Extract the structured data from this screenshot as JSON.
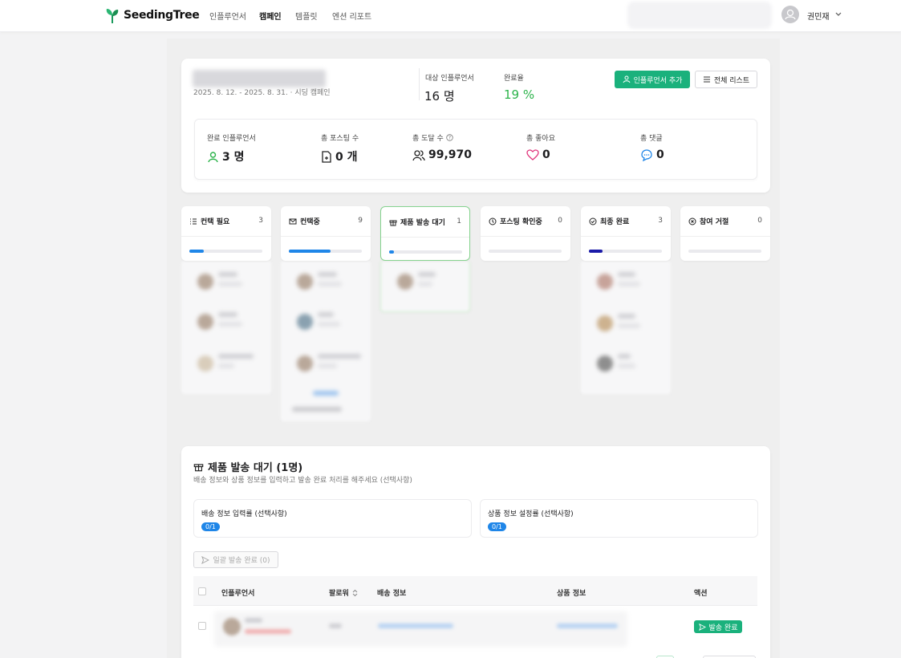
{
  "nav": {
    "brand": "SeedingTree",
    "links": [
      "인플루언서",
      "캠페인",
      "템플릿",
      "엔션 리포트"
    ],
    "user": "권민재"
  },
  "campaign": {
    "dates": "2025. 8. 12. - 2025. 8. 31. · 시딩 캠페인",
    "target_label": "대상 인플루언서",
    "target_value": "16 명",
    "rate_label": "완료율",
    "rate_value": "19 %",
    "add_button": "인플루언서 추가",
    "list_button": "전체 리스트"
  },
  "stats": [
    {
      "label": "완료 인플루언서",
      "value": "3 명",
      "icon": "person-icon"
    },
    {
      "label": "총 포스팅 수",
      "value": "0 개",
      "icon": "document-icon"
    },
    {
      "label": "총 도달 수",
      "value": "99,970",
      "icon": "people-icon"
    },
    {
      "label": "총 좋아요",
      "value": "0",
      "icon": "heart-icon"
    },
    {
      "label": "총 댓글",
      "value": "0",
      "icon": "comment-icon"
    }
  ],
  "columns": [
    {
      "title": "컨택 필요",
      "count": "3",
      "progress": 0.2,
      "color": "#1f86e8"
    },
    {
      "title": "컨택중",
      "count": "9",
      "progress": 0.57,
      "color": "#1f86e8"
    },
    {
      "title": "제품 발송 대기",
      "count": "1",
      "progress": 0.07,
      "color": "#1f86e8"
    },
    {
      "title": "포스팅 확인중",
      "count": "0",
      "progress": 0,
      "color": "#1f86e8"
    },
    {
      "title": "최종 완료",
      "count": "3",
      "progress": 0.19,
      "color": "#1a1aa8"
    },
    {
      "title": "참여 거절",
      "count": "0",
      "progress": 0,
      "color": "#1f86e8"
    }
  ],
  "section": {
    "title": "제품 발송 대기 (1명)",
    "subtitle": "배송 정보와 상품 정보를 입력하고 발송 완료 처리를 해주세요 (선택사항)",
    "shipping_label": "배송 정보 입력률 (선택사항)",
    "shipping_badge": "0/1",
    "product_label": "상품 정보 설정률 (선택사항)",
    "product_badge": "0/1",
    "bulk_button": "일괄 발송 완료 (0)",
    "headers": [
      "인플루언서",
      "팔로워",
      "배송 정보",
      "상품 정보",
      "액션"
    ],
    "send_button": "발송 완료"
  },
  "colors": {
    "accent": "#1ab17c",
    "blue": "#1f86e8"
  }
}
